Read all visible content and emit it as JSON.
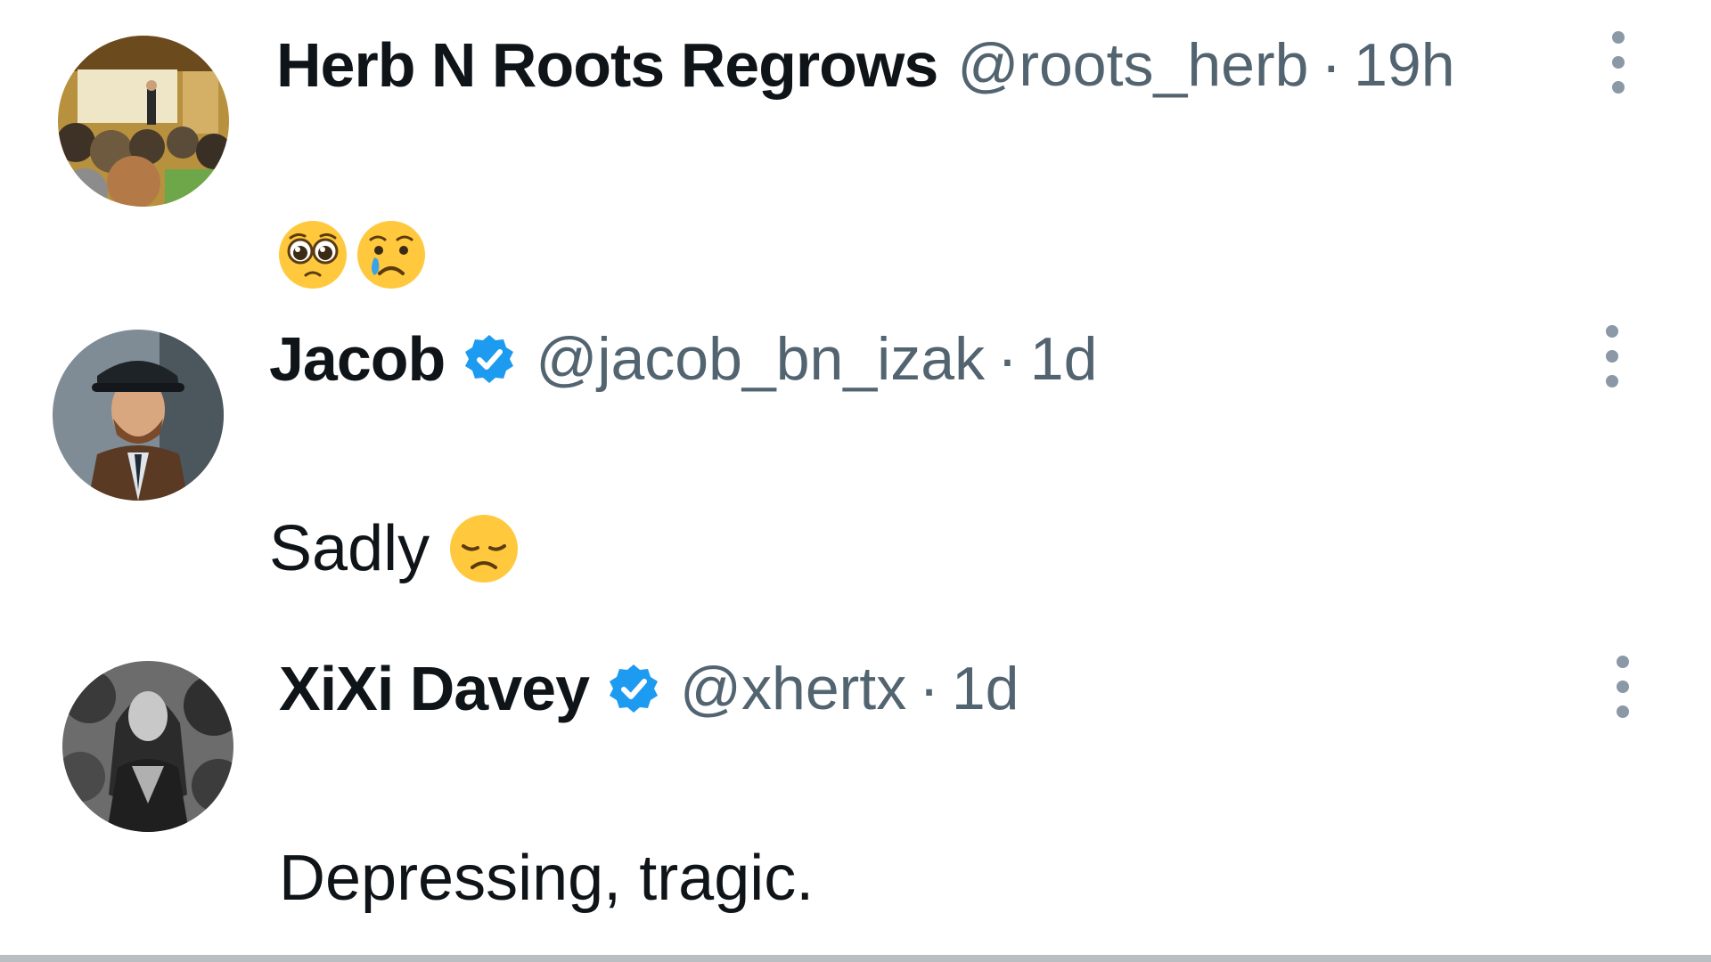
{
  "replies": [
    {
      "display_name": "Herb N Roots Regrows",
      "verified": false,
      "handle": "@roots_herb",
      "separator": "·",
      "time": "19h",
      "text": "",
      "emojis": [
        "pleading-face-emoji",
        "crying-face-emoji"
      ],
      "avatar": "lecture-audience-photo"
    },
    {
      "display_name": "Jacob",
      "verified": true,
      "handle": "@jacob_bn_izak",
      "separator": "·",
      "time": "1d",
      "text": "Sadly",
      "emojis": [
        "disappointed-face-emoji"
      ],
      "avatar": "man-in-flat-cap-photo"
    },
    {
      "display_name": "XiXi Davey",
      "verified": true,
      "handle": "@xhertx",
      "separator": "·",
      "time": "1d",
      "text": "Depressing, tragic.",
      "emojis": [],
      "avatar": "woman-black-and-white-photo"
    }
  ],
  "colors": {
    "name": "#0f1419",
    "secondary": "#536471",
    "verified_blue": "#1d9bf0",
    "emoji_yellow": "#ffc83d",
    "divider": "#b9bec2"
  }
}
